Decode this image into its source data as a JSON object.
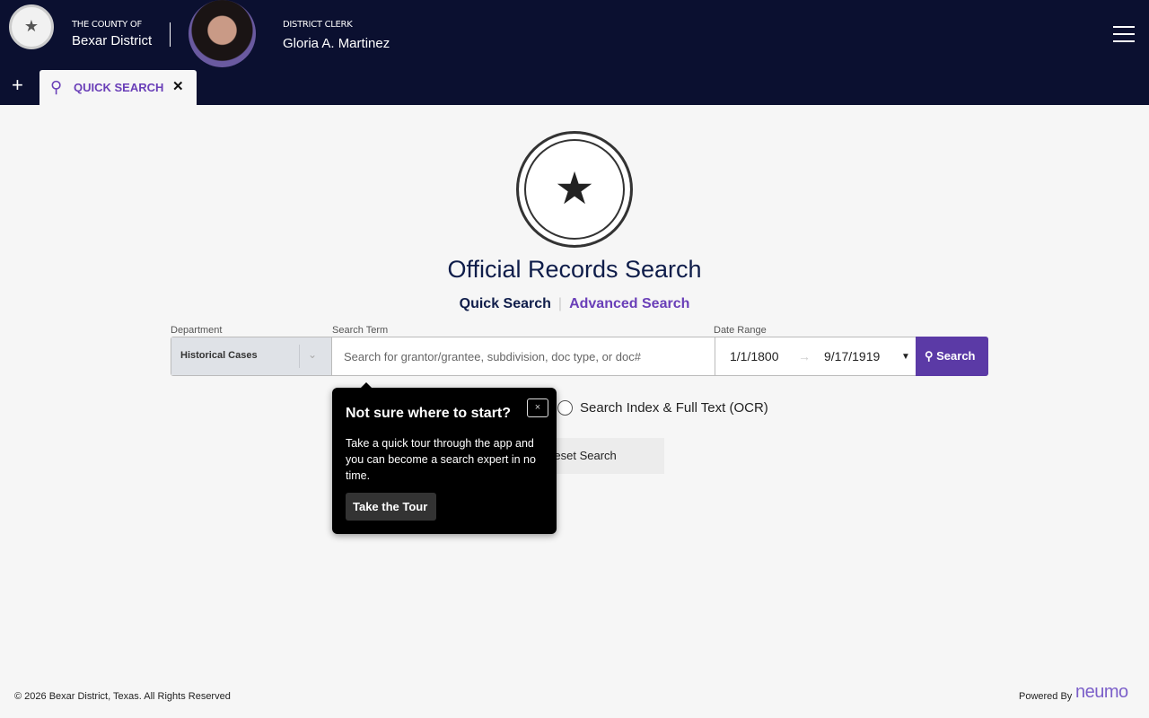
{
  "header": {
    "county_small": "THE COUNTY OF",
    "county_name": "Bexar District",
    "clerk_small": "DISTRICT CLERK",
    "clerk_name": "Gloria A. Martinez"
  },
  "tabs": {
    "add": "+",
    "active": "QUICK SEARCH",
    "close": "✕"
  },
  "main": {
    "title": "Official Records Search",
    "quick": "Quick Search",
    "advanced": "Advanced Search"
  },
  "form": {
    "department_label": "Department",
    "department_value": "Historical Cases",
    "term_label": "Search Term",
    "term_placeholder": "Search for grantor/grantee, subdivision, doc type, or doc#",
    "date_label": "Date Range",
    "date_from": "1/1/1800",
    "date_to": "9/17/1919",
    "search": "Search",
    "radio_label": "Search Index & Full Text (OCR)",
    "reset": "Reset Search"
  },
  "popover": {
    "title": "Not sure where to start?",
    "body": "Take a quick tour through the app and you can become a search expert in no time.",
    "button": "Take the Tour",
    "close": "×"
  },
  "footer": {
    "copyright": "© 2026 Bexar District, Texas. All Rights Reserved",
    "powered": "Powered By",
    "brand": "neumo"
  },
  "colors": {
    "header": "#0b1030",
    "accent": "#5b3aa6"
  }
}
